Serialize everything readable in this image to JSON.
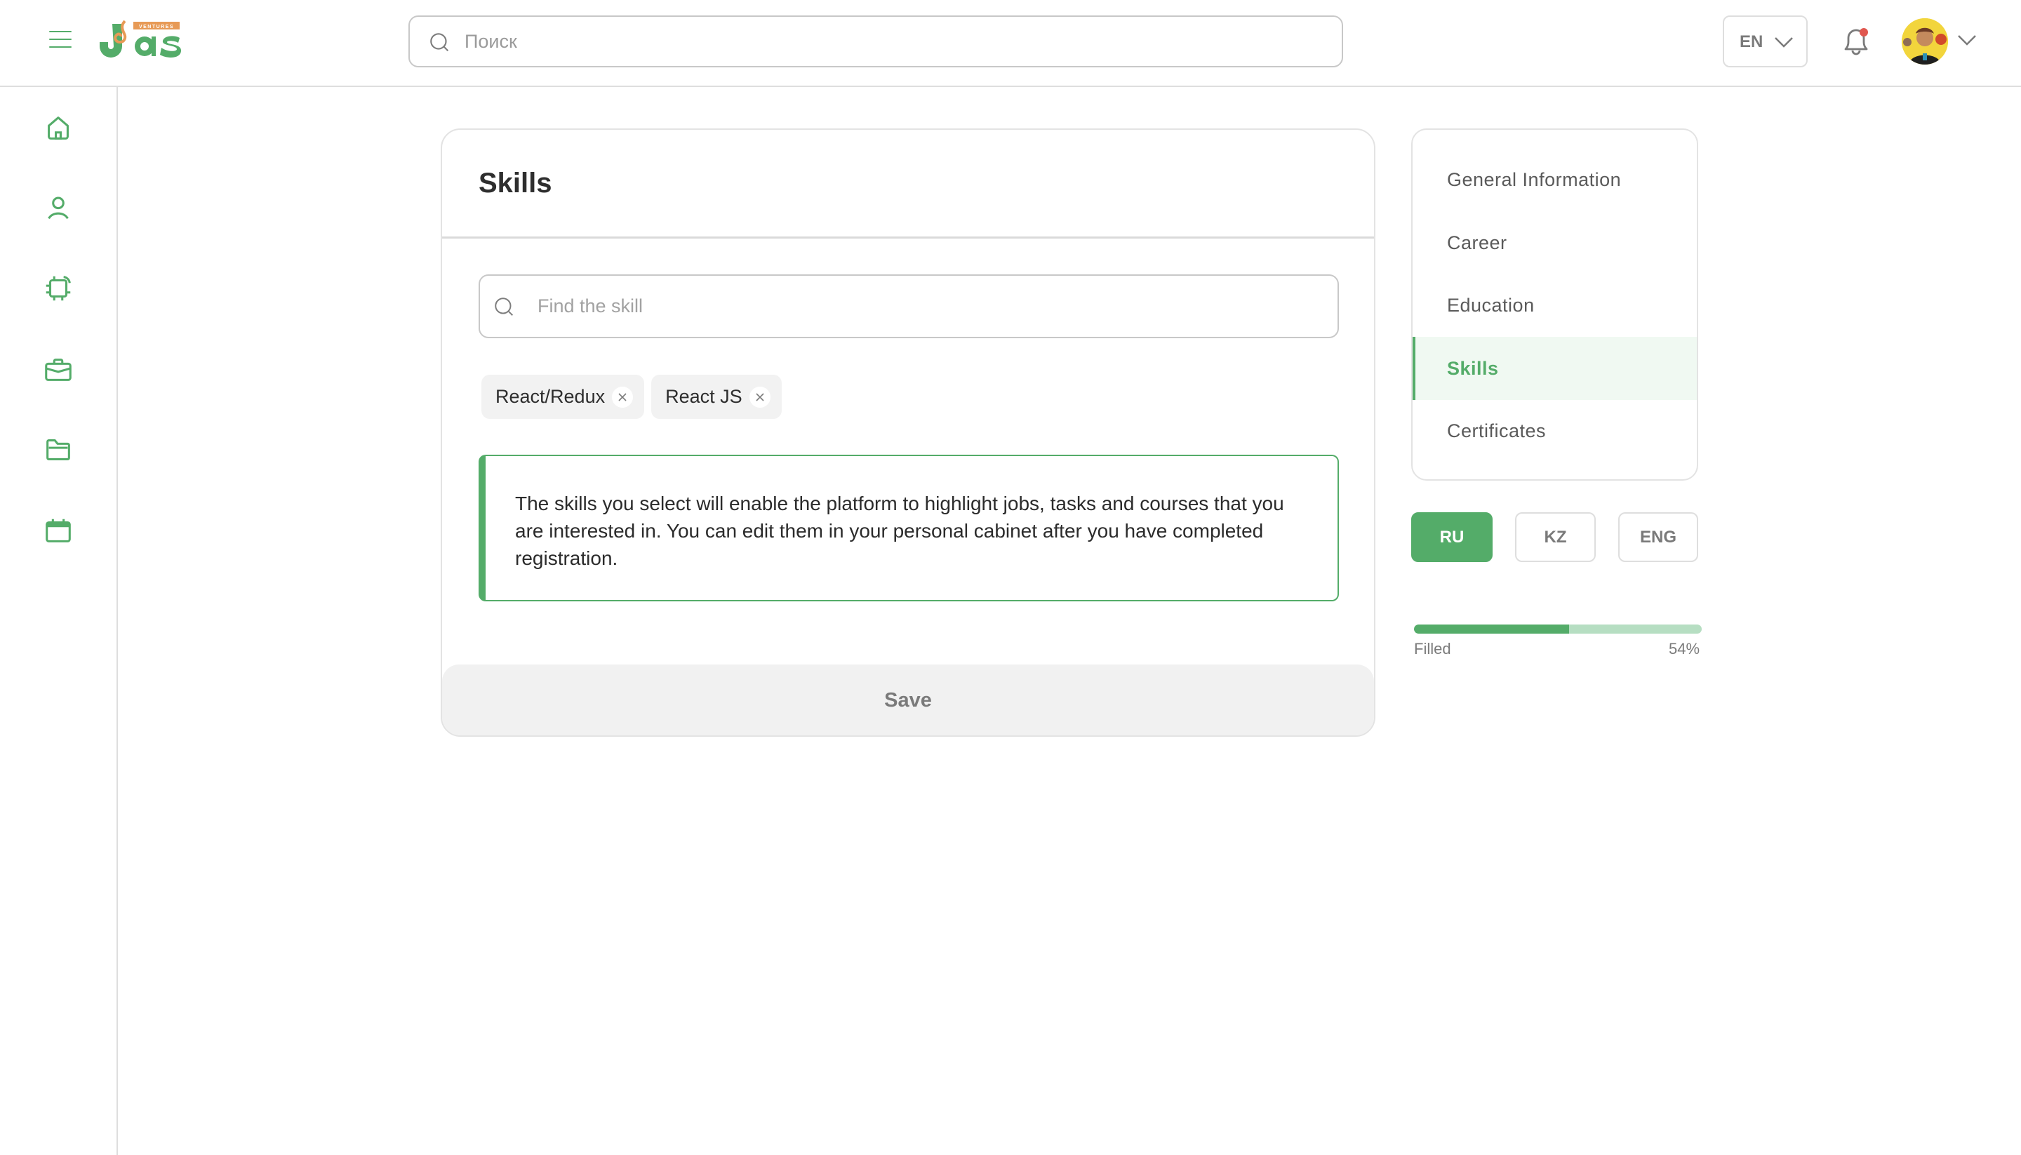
{
  "header": {
    "logo_text": "Jas",
    "logo_tagline": "VENTURES",
    "search_placeholder": "Поиск",
    "search_value": "",
    "language": "EN",
    "notification_dot": true
  },
  "sidebar": {
    "items": [
      {
        "name": "home",
        "icon": "home-icon"
      },
      {
        "name": "profile",
        "icon": "user-icon"
      },
      {
        "name": "tasks",
        "icon": "chip-icon"
      },
      {
        "name": "jobs",
        "icon": "briefcase-icon"
      },
      {
        "name": "projects",
        "icon": "folder-icon"
      },
      {
        "name": "calendar",
        "icon": "calendar-icon"
      }
    ]
  },
  "main": {
    "title": "Skills",
    "skill_search_placeholder": "Find the skill",
    "skill_search_value": "",
    "selected_skills": [
      "React/Redux",
      "React JS"
    ],
    "info_text": "The skills you select will enable the platform to highlight jobs, tasks and courses that you are interested in. You can edit them in your personal cabinet after you have completed registration.",
    "save_label": "Save"
  },
  "profile_nav": {
    "items": [
      {
        "label": "General Information",
        "active": false
      },
      {
        "label": "Career",
        "active": false
      },
      {
        "label": "Education",
        "active": false
      },
      {
        "label": "Skills",
        "active": true
      },
      {
        "label": "Certificates",
        "active": false
      }
    ]
  },
  "content_language": {
    "options": [
      "RU",
      "KZ",
      "ENG"
    ],
    "selected": "RU"
  },
  "progress": {
    "label": "Filled",
    "value_text": "54%",
    "value": 54
  },
  "colors": {
    "accent": "#54ac69",
    "accent_light": "#b6dec2",
    "active_row_bg": "#f0f9f2",
    "logo_orange": "#e79a56",
    "notification": "#e0574f"
  }
}
